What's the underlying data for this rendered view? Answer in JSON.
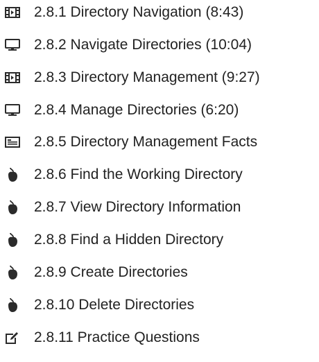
{
  "lesson_items": [
    {
      "label": "2.8.1 Directory Navigation (8:43)",
      "icon": "video-icon"
    },
    {
      "label": "2.8.2 Navigate Directories (10:04)",
      "icon": "demo-monitor-icon"
    },
    {
      "label": "2.8.3 Directory Management (9:27)",
      "icon": "video-icon"
    },
    {
      "label": "2.8.4 Manage Directories (6:20)",
      "icon": "demo-monitor-icon"
    },
    {
      "label": "2.8.5 Directory Management Facts",
      "icon": "facts-document-icon"
    },
    {
      "label": "2.8.6 Find the Working Directory",
      "icon": "lab-mouse-icon"
    },
    {
      "label": "2.8.7 View Directory Information",
      "icon": "lab-mouse-icon"
    },
    {
      "label": "2.8.8 Find a Hidden Directory",
      "icon": "lab-mouse-icon"
    },
    {
      "label": "2.8.9 Create Directories",
      "icon": "lab-mouse-icon"
    },
    {
      "label": "2.8.10 Delete Directories",
      "icon": "lab-mouse-icon"
    },
    {
      "label": "2.8.11 Practice Questions",
      "icon": "quiz-checkbox-icon"
    }
  ],
  "colors": {
    "text": "#222222",
    "icon": "#2b2b2b",
    "background": "#ffffff"
  }
}
